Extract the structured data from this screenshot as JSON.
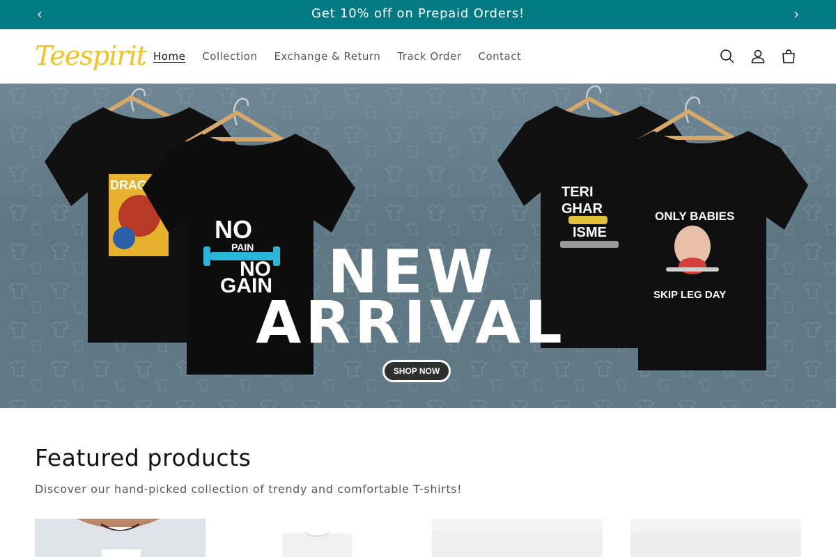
{
  "announcement": {
    "text": "Get 10% off on Prepaid Orders!",
    "prev_icon": "chevron-left-icon",
    "next_icon": "chevron-right-icon"
  },
  "header": {
    "logo_text": "Teespirit",
    "nav": [
      {
        "label": "Home",
        "active": true
      },
      {
        "label": "Collection",
        "active": false
      },
      {
        "label": "Exchange & Return",
        "active": false
      },
      {
        "label": "Track Order",
        "active": false
      },
      {
        "label": "Contact",
        "active": false
      }
    ],
    "icons": [
      "search-icon",
      "account-icon",
      "cart-icon"
    ]
  },
  "hero": {
    "heading_line1": "NEW",
    "heading_line2": "ARRIVAL",
    "cta_label": "SHOP NOW",
    "shirt_prints": {
      "shirt1": "DRAGON",
      "shirt2_line1": "NO",
      "shirt2_line2": "PAIN",
      "shirt2_line3": "NO",
      "shirt2_line4": "GAIN",
      "shirt3_line1": "TERI",
      "shirt3_line2": "GHAR",
      "shirt3_line3": "ISME",
      "shirt4_line1": "ONLY BABIES",
      "shirt4_line2": "SKIP LEG DAY"
    }
  },
  "featured": {
    "title": "Featured products",
    "subtitle": "Discover our hand-picked collection of trendy and comfortable T-shirts!"
  },
  "colors": {
    "announcement_bg": "#027a84",
    "logo": "#f3c31b",
    "hero_bg": "#627a86",
    "accent_cyan": "#29b6d8"
  }
}
